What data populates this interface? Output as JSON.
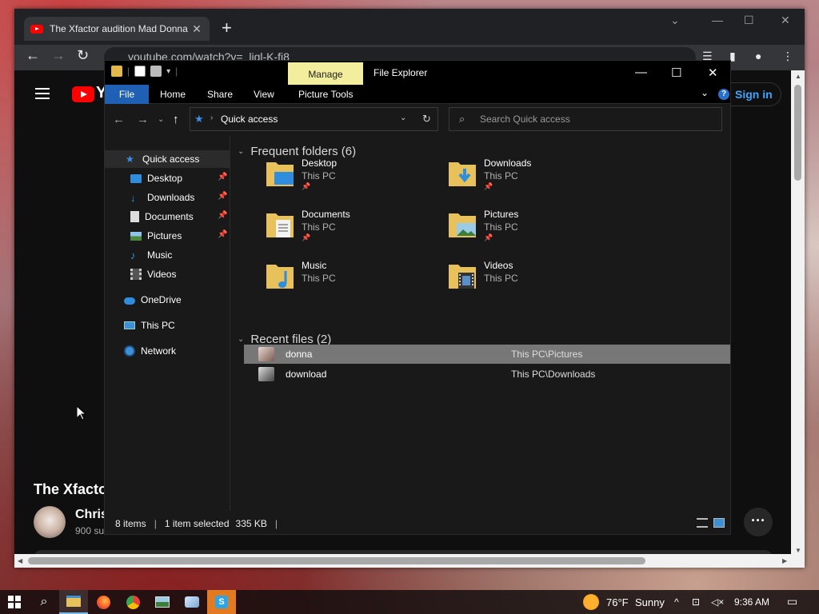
{
  "browser": {
    "tab_title": "The Xfactor audition Mad Donna",
    "url": "youtube.com/watch?v=_ligl-K-fj8",
    "youtube": {
      "logo_text": "Y",
      "sign_in_label": "Sign in",
      "video_title": "The Xfactor",
      "channel_name": "Chris",
      "subscribers": "900 su"
    }
  },
  "explorer": {
    "title": "File Explorer",
    "manage_label": "Manage",
    "ribbon_tabs": [
      "File",
      "Home",
      "Share",
      "View",
      "Picture Tools"
    ],
    "address_path": "Quick access",
    "search_placeholder": "Search Quick access",
    "nav": {
      "quick_access": "Quick access",
      "desktop": "Desktop",
      "downloads": "Downloads",
      "documents": "Documents",
      "pictures": "Pictures",
      "music": "Music",
      "videos": "Videos",
      "onedrive": "OneDrive",
      "this_pc": "This PC",
      "network": "Network"
    },
    "frequent_header": "Frequent folders (6)",
    "folders": [
      {
        "name": "Desktop",
        "location": "This PC",
        "pinned": true
      },
      {
        "name": "Downloads",
        "location": "This PC",
        "pinned": true
      },
      {
        "name": "Documents",
        "location": "This PC",
        "pinned": true
      },
      {
        "name": "Pictures",
        "location": "This PC",
        "pinned": true
      },
      {
        "name": "Music",
        "location": "This PC",
        "pinned": false
      },
      {
        "name": "Videos",
        "location": "This PC",
        "pinned": false
      }
    ],
    "recent_header": "Recent files (2)",
    "recent_files": [
      {
        "name": "donna",
        "path": "This PC\\Pictures",
        "selected": true
      },
      {
        "name": "download",
        "path": "This PC\\Downloads",
        "selected": false
      }
    ],
    "status": {
      "items": "8 items",
      "selection": "1 item selected",
      "size": "335 KB"
    }
  },
  "taskbar": {
    "weather_temp": "76°F",
    "weather_text": "Sunny",
    "time": "9:36 AM"
  },
  "colors": {
    "explorer_bg": "#191919",
    "ribbon_file": "#1f5fb4",
    "manage_tab": "#f3ee9e",
    "youtube_red": "#ff0000",
    "selection": "#777777"
  }
}
